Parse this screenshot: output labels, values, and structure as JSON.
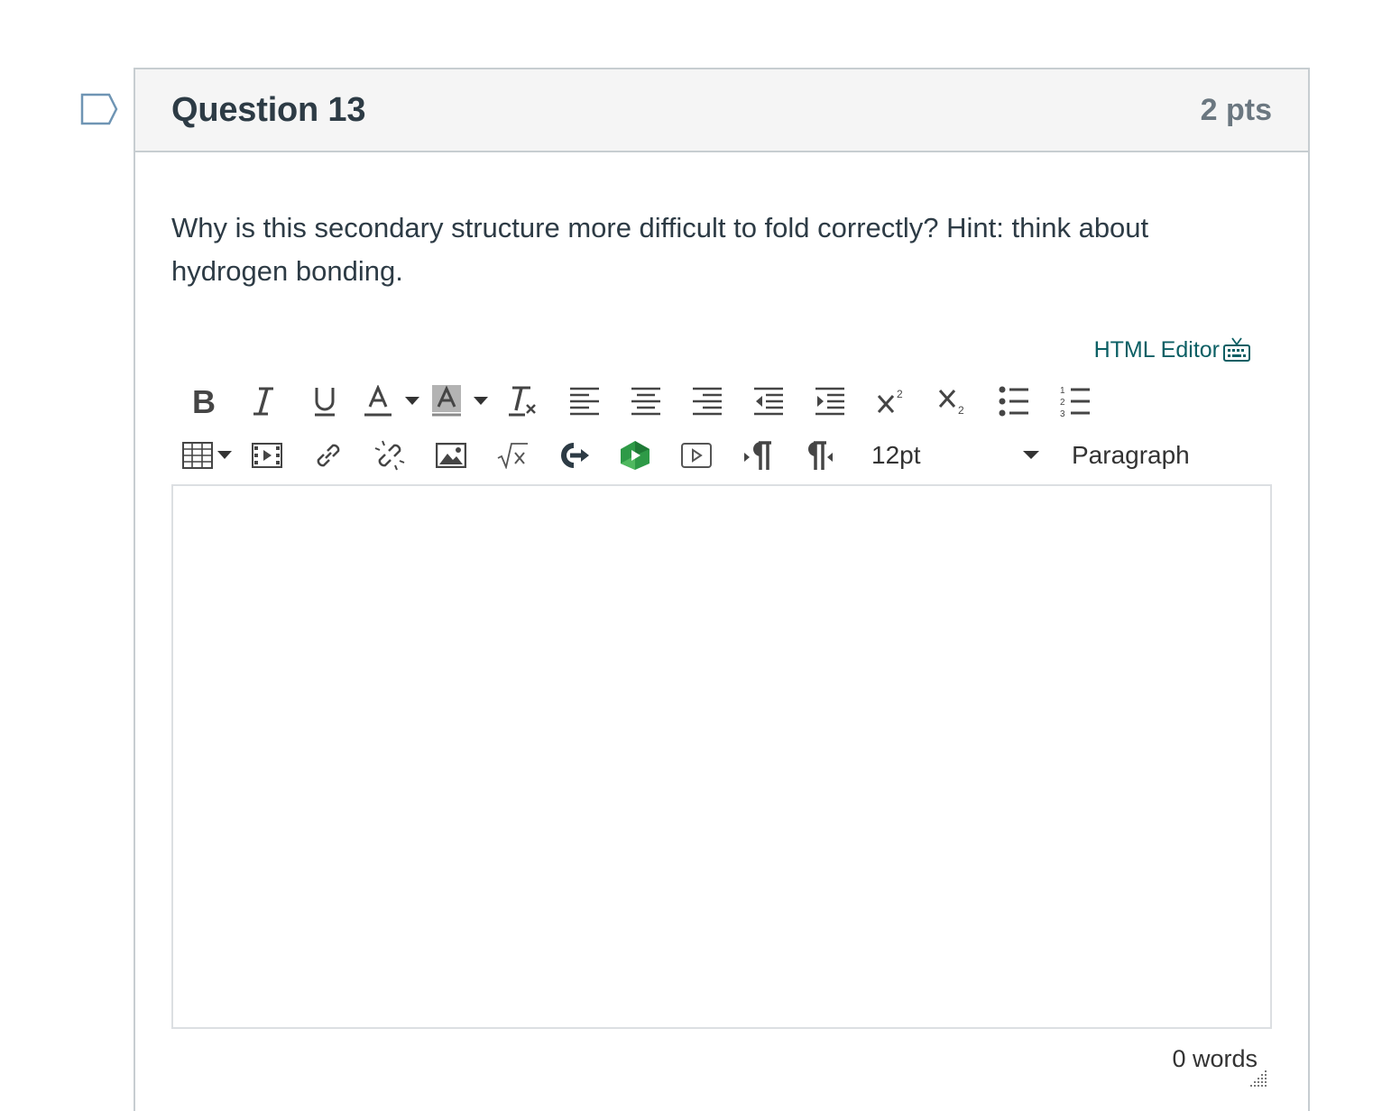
{
  "question": {
    "title": "Question 13",
    "points": "2 pts",
    "text": "Why is this secondary structure more difficult to fold correctly? Hint: think about hydrogen bonding."
  },
  "editor": {
    "html_editor_label": "HTML Editor",
    "font_size": "12pt",
    "block_format": "Paragraph",
    "word_count": "0 words",
    "content": ""
  },
  "toolbar": {
    "row1": [
      "bold-icon",
      "italic-icon",
      "underline-icon",
      "text-color-icon",
      "background-color-icon",
      "clear-formatting-icon",
      "align-left-icon",
      "align-center-icon",
      "align-right-icon",
      "outdent-icon",
      "indent-icon",
      "superscript-icon",
      "subscript-icon",
      "bulleted-list-icon",
      "numbered-list-icon"
    ],
    "row2": [
      "table-icon",
      "embed-media-icon",
      "link-icon",
      "unlink-icon",
      "image-icon",
      "math-equation-icon",
      "lti-tool-icon",
      "kaltura-media-icon",
      "record-media-icon",
      "ltr-paragraph-icon",
      "rtl-paragraph-icon"
    ]
  },
  "colors": {
    "header_bg": "#f5f5f5",
    "border": "#c7cdd1",
    "link": "#0b5f64",
    "text": "#2d3b45",
    "kaltura_green": "#2e9a47"
  }
}
